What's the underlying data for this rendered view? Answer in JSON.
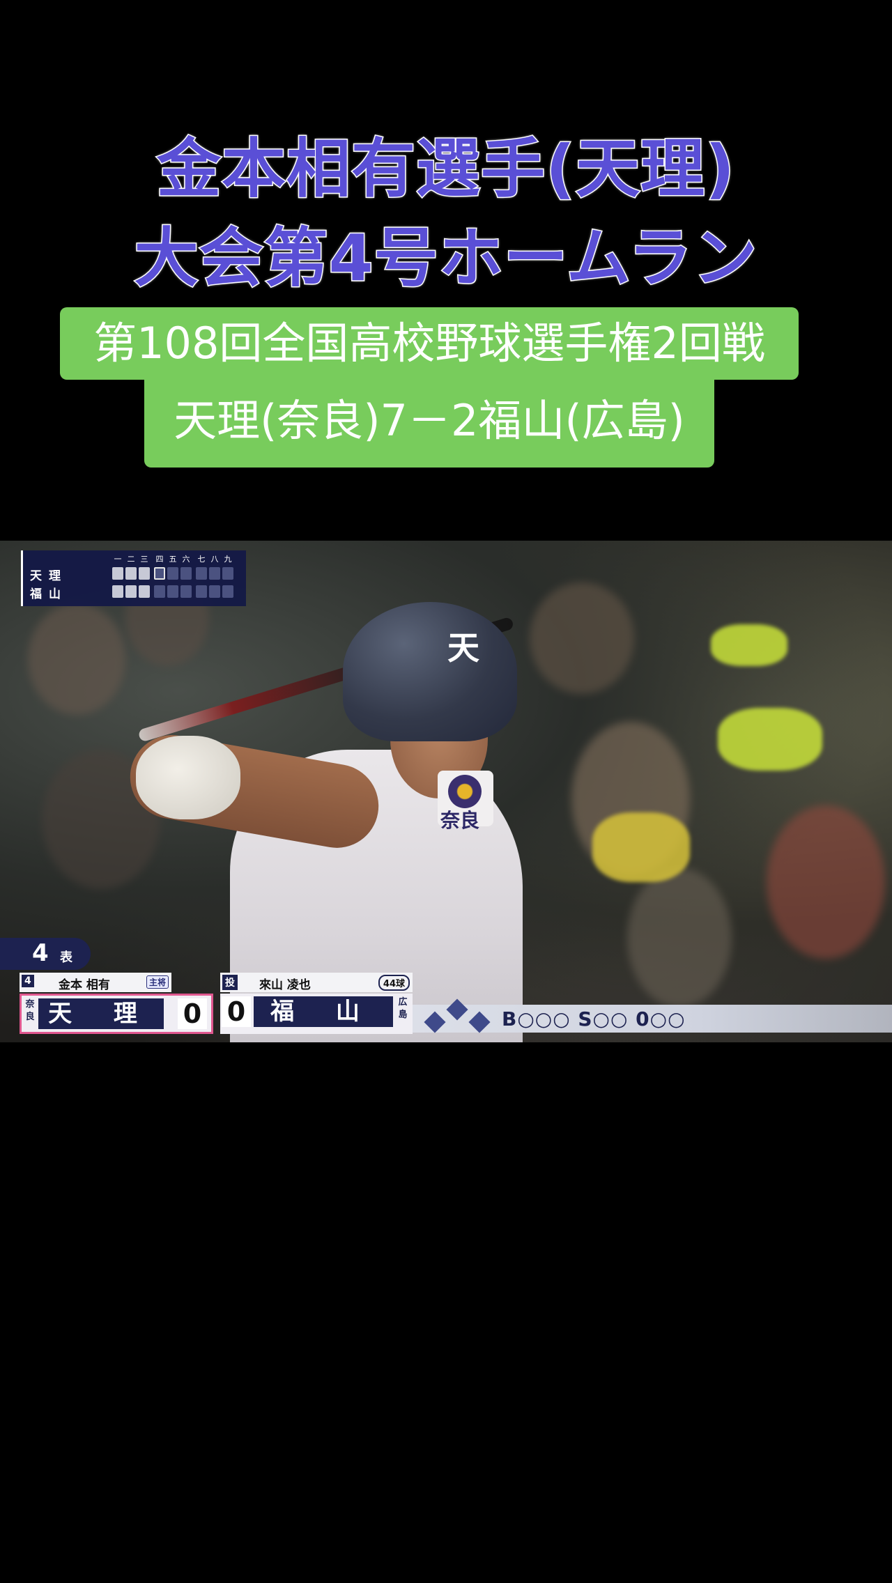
{
  "headline": {
    "line1": "金本相有選手(天理)",
    "line2": "大会第4号ホームラン"
  },
  "caption": {
    "line1": "第108回全国高校野球選手権2回戦",
    "line2": "天理(奈良)7－2福山(広島)"
  },
  "inning_board": {
    "innings": [
      "一",
      "二",
      "三",
      "四",
      "五",
      "六",
      "七",
      "八",
      "九"
    ],
    "teams": [
      "天理",
      "福山"
    ]
  },
  "scorebug": {
    "inning": "4",
    "half": "表",
    "batter": {
      "order": "4",
      "name": "金本 相有",
      "badge": "主将"
    },
    "pitcher": {
      "role": "投",
      "name": "來山 凌也",
      "pitch_count": "44球"
    },
    "home": {
      "pref": "奈良",
      "team": "天 理",
      "score": "0"
    },
    "away": {
      "pref": "広島",
      "team": "福 山",
      "score": "0"
    },
    "count": "B○○○ S○○ 0○○"
  },
  "player": {
    "helmet_mark": "天",
    "sleeve_text": "奈良"
  },
  "colors": {
    "headline": "#5a4fd6",
    "caption_bg": "#78cc5c",
    "scorebug_navy": "#1d2250",
    "home_highlight": "#e0578f"
  }
}
